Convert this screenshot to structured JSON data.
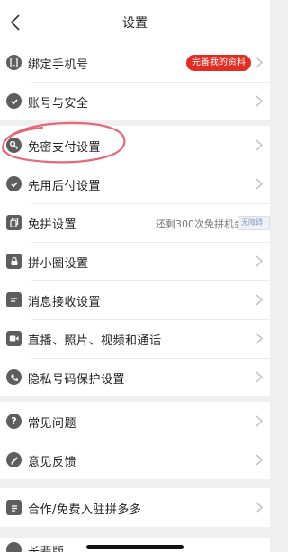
{
  "header": {
    "title": "设置",
    "back_icon": "chevron-left-icon"
  },
  "groups": [
    {
      "items": [
        {
          "label": "绑定手机号",
          "icon": "phone-icon",
          "badge": "完善我的资料"
        },
        {
          "label": "账号与安全",
          "icon": "shield-check-icon"
        }
      ]
    },
    {
      "items": [
        {
          "label": "免密支付设置",
          "icon": "key-icon",
          "annotated": true
        },
        {
          "label": "先用后付设置",
          "icon": "badge-check-icon"
        },
        {
          "label": "免拼设置",
          "icon": "copy-icon",
          "hint": "还剩300次免拼机会"
        },
        {
          "label": "拼小圈设置",
          "icon": "lock-icon"
        },
        {
          "label": "消息接收设置",
          "icon": "message-icon"
        },
        {
          "label": "直播、照片、视频和通话",
          "icon": "video-icon"
        },
        {
          "label": "隐私号码保护设置",
          "icon": "privacy-phone-icon"
        }
      ]
    },
    {
      "items": [
        {
          "label": "常见问题",
          "icon": "question-icon"
        },
        {
          "label": "意见反馈",
          "icon": "pencil-icon"
        }
      ]
    },
    {
      "items": [
        {
          "label": "合作/免费入驻拼多多",
          "icon": "list-icon"
        }
      ]
    },
    {
      "items": [
        {
          "label": "长辈版",
          "icon": "elder-icon"
        }
      ]
    }
  ],
  "watermark": "无障碍",
  "colors": {
    "badge_bg": "#e02e24",
    "annotation": "#e26a7a",
    "icon_fill": "#5e5e5e",
    "background": "#efefef"
  }
}
